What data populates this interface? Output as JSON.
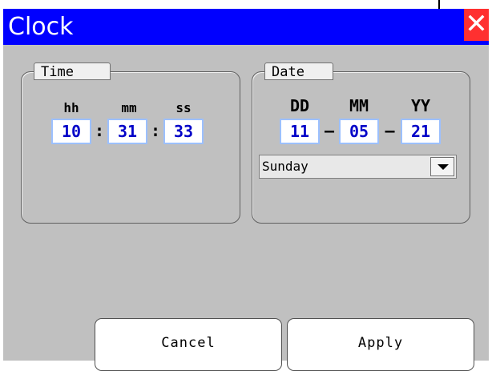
{
  "window": {
    "title": "Clock",
    "close_glyph": "✕"
  },
  "time": {
    "label": "Time",
    "headers": {
      "hh": "hh",
      "mm": "mm",
      "ss": "ss"
    },
    "hours": "10",
    "minutes": "31",
    "seconds": "33",
    "separator": ":"
  },
  "date": {
    "label": "Date",
    "headers": {
      "dd": "DD",
      "mm": "MM",
      "yy": "YY"
    },
    "day": "11",
    "month": "05",
    "year": "21",
    "separator": "–",
    "weekday_selected": "Sunday"
  },
  "buttons": {
    "cancel": "Cancel",
    "apply": "Apply"
  },
  "colors": {
    "titlebar": "#0000ff",
    "close": "#ff3030",
    "field_text": "#0000c8",
    "field_border": "#9cc0ff",
    "background": "#c0c0c0"
  },
  "icons": {
    "close": "close-icon",
    "dropdown": "chevron-down-icon"
  }
}
